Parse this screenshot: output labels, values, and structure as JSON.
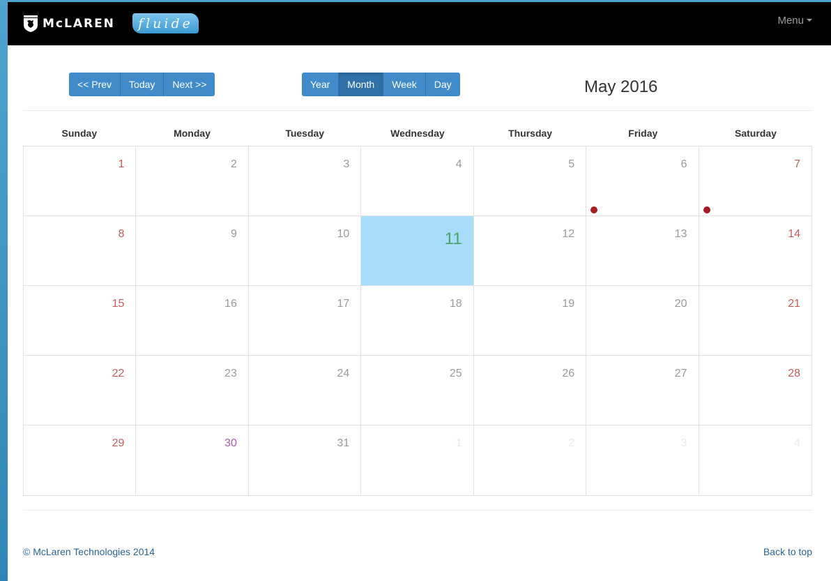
{
  "header": {
    "brand_text": "McLAREN",
    "product_text": "fluide",
    "menu_label": "Menu"
  },
  "toolbar": {
    "nav_buttons": [
      "<< Prev",
      "Today",
      "Next >>"
    ],
    "view_buttons": [
      "Year",
      "Month",
      "Week",
      "Day"
    ],
    "active_view": "Month"
  },
  "calendar": {
    "title": "May 2016",
    "weekdays": [
      "Sunday",
      "Monday",
      "Tuesday",
      "Wednesday",
      "Thursday",
      "Friday",
      "Saturday"
    ],
    "days": [
      {
        "label": "1",
        "type": "weekend"
      },
      {
        "label": "2",
        "type": "normal"
      },
      {
        "label": "3",
        "type": "normal"
      },
      {
        "label": "4",
        "type": "normal"
      },
      {
        "label": "5",
        "type": "normal"
      },
      {
        "label": "6",
        "type": "normal",
        "event": true
      },
      {
        "label": "7",
        "type": "weekend",
        "event": true
      },
      {
        "label": "8",
        "type": "weekend"
      },
      {
        "label": "9",
        "type": "normal"
      },
      {
        "label": "10",
        "type": "normal"
      },
      {
        "label": "11",
        "type": "today"
      },
      {
        "label": "12",
        "type": "normal"
      },
      {
        "label": "13",
        "type": "normal"
      },
      {
        "label": "14",
        "type": "weekend"
      },
      {
        "label": "15",
        "type": "weekend"
      },
      {
        "label": "16",
        "type": "normal"
      },
      {
        "label": "17",
        "type": "normal"
      },
      {
        "label": "18",
        "type": "normal"
      },
      {
        "label": "19",
        "type": "normal"
      },
      {
        "label": "20",
        "type": "normal"
      },
      {
        "label": "21",
        "type": "weekend"
      },
      {
        "label": "22",
        "type": "weekend"
      },
      {
        "label": "23",
        "type": "normal"
      },
      {
        "label": "24",
        "type": "normal"
      },
      {
        "label": "25",
        "type": "normal"
      },
      {
        "label": "26",
        "type": "normal"
      },
      {
        "label": "27",
        "type": "normal"
      },
      {
        "label": "28",
        "type": "weekend"
      },
      {
        "label": "29",
        "type": "weekend"
      },
      {
        "label": "30",
        "type": "holiday"
      },
      {
        "label": "31",
        "type": "normal"
      },
      {
        "label": "1",
        "type": "outmonth"
      },
      {
        "label": "2",
        "type": "outmonth"
      },
      {
        "label": "3",
        "type": "outmonth"
      },
      {
        "label": "4",
        "type": "outmonth"
      }
    ],
    "colors": {
      "today_bg": "#a8ddfa",
      "weekend_text": "#c45a5a",
      "holiday_text": "#b057b0",
      "event_dot": "#a51c24",
      "button_bg": "#428bca"
    }
  },
  "footer": {
    "copyright": "© McLaren Technologies 2014",
    "back_to_top": "Back to top"
  }
}
